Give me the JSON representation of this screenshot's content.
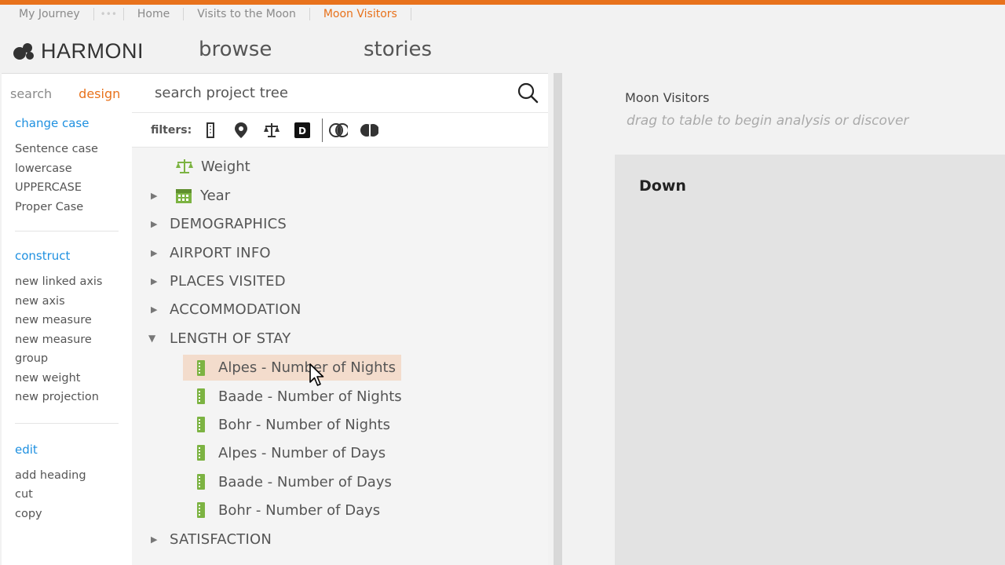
{
  "breadcrumbs": [
    "My Journey",
    "Home",
    "Visits to the Moon",
    "Moon Visitors"
  ],
  "brand": {
    "name": "HARMONI",
    "accent": "#e8721c"
  },
  "nav": {
    "browse": "browse",
    "stories": "stories"
  },
  "left_panel": {
    "tabs": {
      "search": "search",
      "design": "design"
    },
    "sections": [
      {
        "title": "change case",
        "items": [
          "Sentence case",
          "lowercase",
          "UPPERCASE",
          "Proper Case"
        ]
      },
      {
        "title": "construct",
        "items": [
          "new linked axis",
          "new axis",
          "new measure",
          "new measure group",
          "new weight",
          "new projection"
        ]
      },
      {
        "title": "edit",
        "items": [
          "add heading",
          "cut",
          "copy"
        ]
      }
    ]
  },
  "tree": {
    "search_placeholder": "search project tree",
    "filters_label": "filters:",
    "filter_icons": [
      "measure-filter-icon",
      "location-filter-icon",
      "weight-filter-icon",
      "date-filter-icon",
      "overlap-filter-icon",
      "half-filter-icon"
    ],
    "nodes": {
      "weight": "Weight",
      "year": "Year",
      "demographics": "DEMOGRAPHICS",
      "airport": "AIRPORT INFO",
      "places": "PLACES VISITED",
      "accommodation": "ACCOMMODATION",
      "length": "LENGTH OF STAY",
      "m1": "Alpes - Number of Nights",
      "m2": "Baade - Number of Nights",
      "m3": "Bohr - Number of Nights",
      "m4": "Alpes - Number of Days",
      "m5": "Baade - Number of Days",
      "m6": "Bohr - Number of Days",
      "satisfaction": "SATISFACTION"
    }
  },
  "right_panel": {
    "title": "Moon Visitors",
    "hint": "drag to table to begin analysis or discover",
    "dropzone_label": "Down"
  }
}
